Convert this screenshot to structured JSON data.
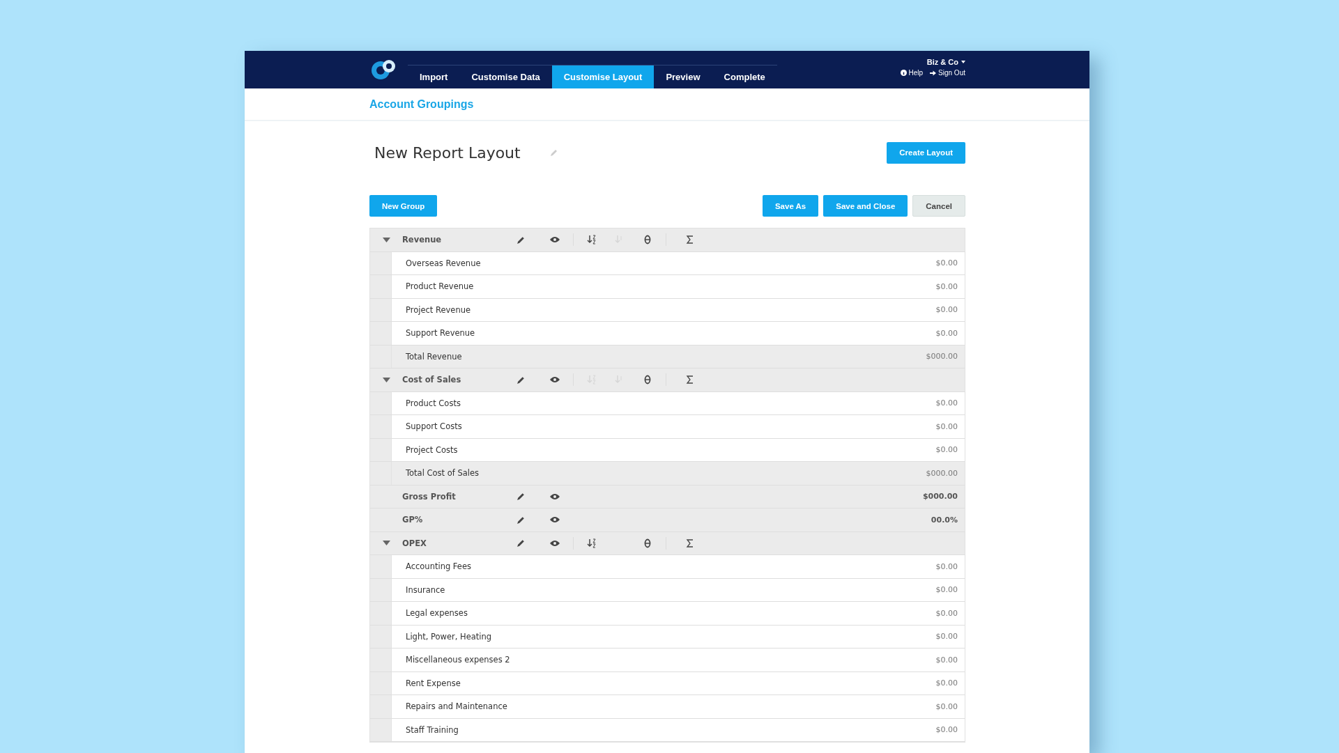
{
  "header": {
    "nav": [
      {
        "label": "Import",
        "selected": false
      },
      {
        "label": "Customise Data",
        "selected": false
      },
      {
        "label": "Customise Layout",
        "selected": true
      },
      {
        "label": "Preview",
        "selected": false
      },
      {
        "label": "Complete",
        "selected": false
      }
    ],
    "company": "Biz & Co",
    "links": [
      {
        "kind": "help",
        "label": "Help"
      },
      {
        "kind": "sign-out",
        "label": "Sign Out"
      }
    ]
  },
  "page_title": "Account Groupings",
  "layout": {
    "name": "New Report Layout",
    "primary_action": "Create Layout"
  },
  "toolbar": {
    "left": [
      {
        "label": "New Group",
        "kind": "primary"
      }
    ],
    "right": [
      {
        "label": "Save As",
        "kind": "primary"
      },
      {
        "label": "Save and Close",
        "kind": "primary"
      },
      {
        "label": "Cancel",
        "kind": "secondary"
      }
    ]
  },
  "groups": [
    {
      "kind": "group",
      "name": "Revenue",
      "expanded": true,
      "tools": [
        {
          "kind": "sort-az",
          "disabled": false
        },
        {
          "kind": "sort-za",
          "disabled": true
        },
        {
          "kind": "zero",
          "disabled": false
        },
        {
          "kind": "sum",
          "disabled": false
        }
      ],
      "rows": [
        {
          "kind": "item",
          "label": "Overseas Revenue",
          "amount": "$0.00"
        },
        {
          "kind": "item",
          "label": "Product Revenue",
          "amount": "$0.00"
        },
        {
          "kind": "item",
          "label": "Project Revenue",
          "amount": "$0.00"
        },
        {
          "kind": "item",
          "label": "Support Revenue",
          "amount": "$0.00"
        },
        {
          "kind": "total",
          "label": "Total Revenue",
          "amount": "$000.00"
        }
      ]
    },
    {
      "kind": "group",
      "name": "Cost of Sales",
      "expanded": true,
      "tools": [
        {
          "kind": "sort-az",
          "disabled": true
        },
        {
          "kind": "sort-za",
          "disabled": true
        },
        {
          "kind": "zero",
          "disabled": false
        },
        {
          "kind": "sum",
          "disabled": false
        }
      ],
      "rows": [
        {
          "kind": "item",
          "label": "Product Costs",
          "amount": "$0.00"
        },
        {
          "kind": "item",
          "label": "Support Costs",
          "amount": "$0.00"
        },
        {
          "kind": "item",
          "label": "Project Costs",
          "amount": "$0.00"
        },
        {
          "kind": "total",
          "label": "Total Cost of Sales",
          "amount": "$000.00"
        }
      ]
    },
    {
      "kind": "calc",
      "name": "Gross Profit",
      "amount": "$000.00"
    },
    {
      "kind": "calc",
      "name": "GP%",
      "amount": "00.0%"
    },
    {
      "kind": "group",
      "name": "OPEX",
      "expanded": true,
      "tools": [
        {
          "kind": "sort-az",
          "disabled": false
        },
        {
          "kind": "zero",
          "disabled": false
        },
        {
          "kind": "sum",
          "disabled": false
        }
      ],
      "rows": [
        {
          "kind": "item",
          "label": "Accounting Fees",
          "amount": "$0.00"
        },
        {
          "kind": "item",
          "label": "Insurance",
          "amount": "$0.00"
        },
        {
          "kind": "item",
          "label": "Legal expenses",
          "amount": "$0.00"
        },
        {
          "kind": "item",
          "label": "Light, Power, Heating",
          "amount": "$0.00"
        },
        {
          "kind": "item",
          "label": "Miscellaneous expenses 2",
          "amount": "$0.00"
        },
        {
          "kind": "item",
          "label": "Rent Expense",
          "amount": "$0.00"
        },
        {
          "kind": "item",
          "label": "Repairs and Maintenance",
          "amount": "$0.00"
        },
        {
          "kind": "item",
          "label": "Staff Training",
          "amount": "$0.00"
        }
      ]
    }
  ]
}
